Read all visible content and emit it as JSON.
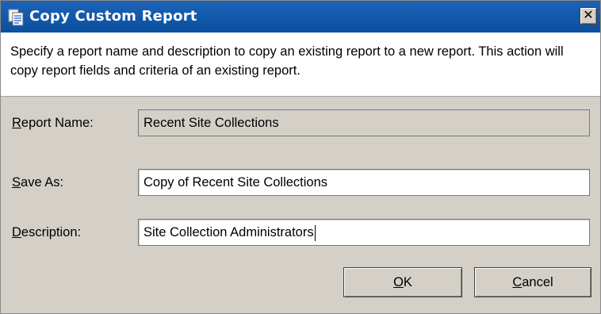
{
  "window": {
    "title": "Copy Custom Report",
    "icon": "copy-report-icon",
    "close_glyph": "✕"
  },
  "description": "Specify a report name and description to copy an existing report to a new report. This action will copy report fields and criteria of an existing report.",
  "fields": {
    "report_name": {
      "label_mnemonic": "R",
      "label_rest": "eport Name:",
      "value": "Recent Site Collections"
    },
    "save_as": {
      "label_mnemonic": "S",
      "label_rest": "ave As:",
      "value": "Copy of Recent Site Collections"
    },
    "description": {
      "label_mnemonic": "D",
      "label_rest": "escription:",
      "value": "Site Collection Administrators"
    }
  },
  "buttons": {
    "ok": {
      "mnemonic": "O",
      "rest": "K"
    },
    "cancel": {
      "mnemonic": "C",
      "rest": "ancel"
    }
  },
  "colors": {
    "titlebar": "#0a4f9e",
    "dialog_bg": "#d4d0c8"
  }
}
